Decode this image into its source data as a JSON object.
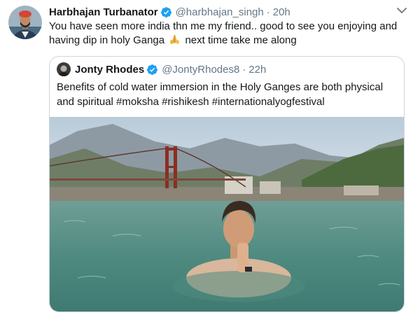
{
  "tweet": {
    "author_name": "Harbhajan Turbanator",
    "author_handle": "@harbhajan_singh",
    "separator": "·",
    "time": "20h",
    "text_line1": "You have seen more india thn me my friend.. good to see you enjoying and",
    "text_line2_a": "having dip in holy Ganga",
    "text_line2_b": "next time take me along",
    "avatar_icon": "person-avatar",
    "verified_icon": "verified-badge-icon",
    "caret_icon": "chevron-down-icon"
  },
  "quoted_tweet": {
    "author_name": "Jonty Rhodes",
    "author_handle": "@JontyRhodes8",
    "separator": "·",
    "time": "22h",
    "text_line1": "Benefits of cold water immersion in the Holy Ganges are both physical",
    "text_line2": "and spiritual #moksha #rishikesh #internationalyogfestival",
    "image_subject": "man in river with praying hands, suspension bridge and mountains behind"
  },
  "colors": {
    "text_primary": "#14171a",
    "text_secondary": "#657786",
    "border": "#ccd6dd",
    "verified": "#1da1f2",
    "water": "#5a8f86",
    "sky": "#c7d6e2"
  }
}
